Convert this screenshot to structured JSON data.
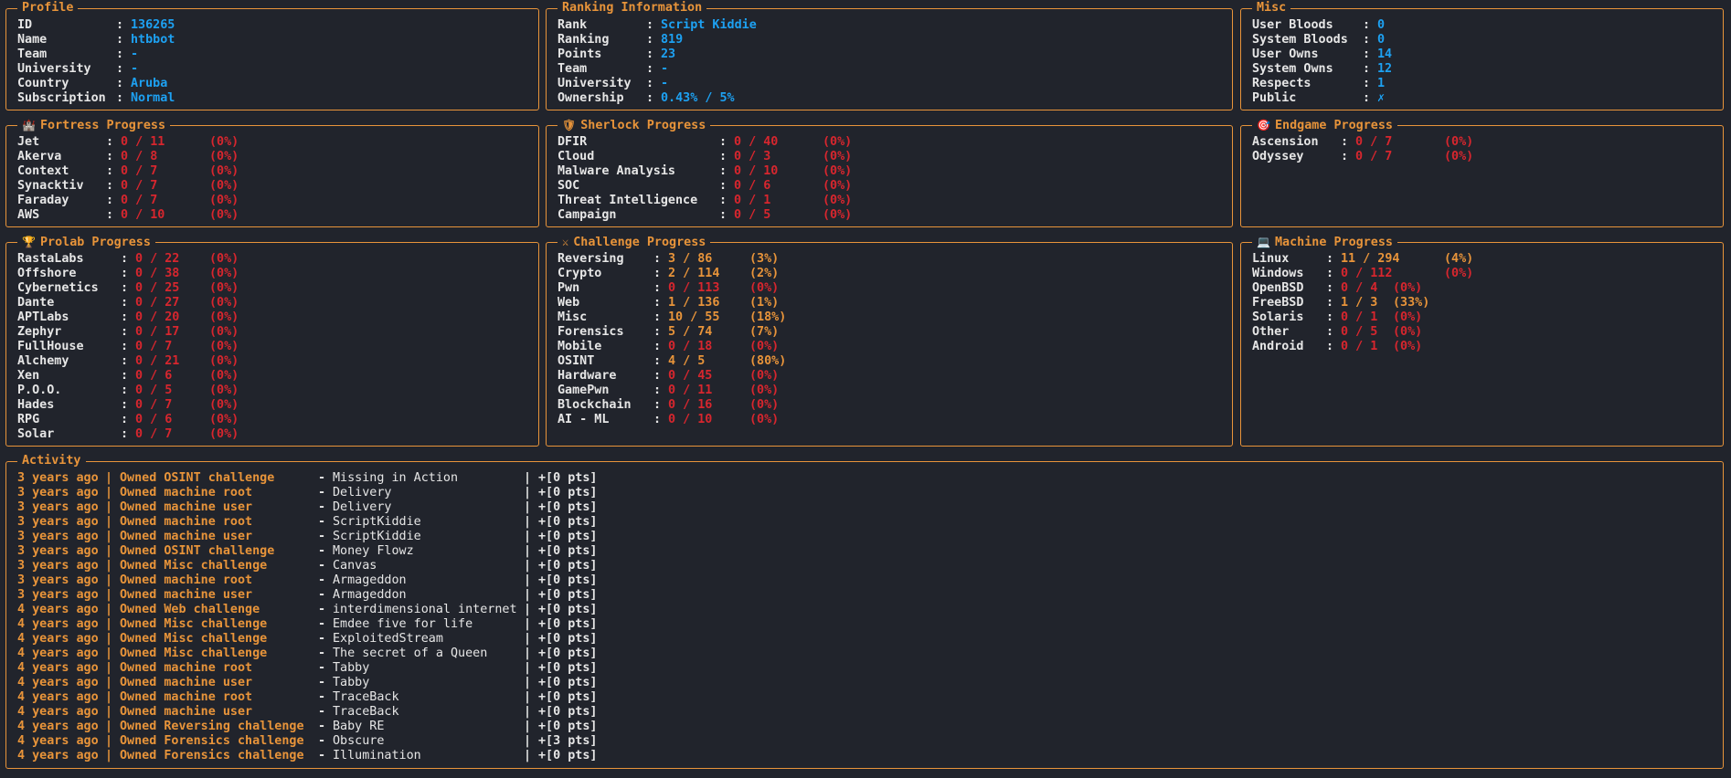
{
  "colors": {
    "accent": "#e8943a",
    "value": "#1da1f2",
    "zero": "#d7262e",
    "background": "#21242c"
  },
  "profile": {
    "title": "Profile",
    "rows": [
      {
        "label": "ID",
        "value": "136265"
      },
      {
        "label": "Name",
        "value": "htbbot"
      },
      {
        "label": "Team",
        "value": "-"
      },
      {
        "label": "University",
        "value": "-"
      },
      {
        "label": "Country",
        "value": "Aruba"
      },
      {
        "label": "Subscription",
        "value": "Normal"
      }
    ]
  },
  "ranking": {
    "title": "Ranking Information",
    "rows": [
      {
        "label": "Rank",
        "value": "Script Kiddie"
      },
      {
        "label": "Ranking",
        "value": "819"
      },
      {
        "label": "Points",
        "value": "23"
      },
      {
        "label": "Team",
        "value": "-"
      },
      {
        "label": "University",
        "value": "-"
      },
      {
        "label": "Ownership",
        "value": "0.43% / 5%"
      }
    ]
  },
  "misc": {
    "title": "Misc",
    "rows": [
      {
        "label": "User Bloods",
        "value": "0"
      },
      {
        "label": "System Bloods",
        "value": "0"
      },
      {
        "label": "User Owns",
        "value": "14"
      },
      {
        "label": "System Owns",
        "value": "12"
      },
      {
        "label": "Respects",
        "value": "1"
      },
      {
        "label": "Public",
        "value": "✗"
      }
    ]
  },
  "fortress": {
    "title": "Fortress Progress",
    "icon": "castle-icon",
    "glyph": "🏰",
    "rows": [
      {
        "label": "Jet",
        "value": "0 / 11",
        "pct": "(0%)",
        "state": "zero"
      },
      {
        "label": "Akerva",
        "value": "0 / 8",
        "pct": "(0%)",
        "state": "zero"
      },
      {
        "label": "Context",
        "value": "0 / 7",
        "pct": "(0%)",
        "state": "zero"
      },
      {
        "label": "Synacktiv",
        "value": "0 / 7",
        "pct": "(0%)",
        "state": "zero"
      },
      {
        "label": "Faraday",
        "value": "0 / 7",
        "pct": "(0%)",
        "state": "zero"
      },
      {
        "label": "AWS",
        "value": "0 / 10",
        "pct": "(0%)",
        "state": "zero"
      }
    ]
  },
  "sherlock": {
    "title": "Sherlock Progress",
    "icon": "shield-icon",
    "glyph": "🛡",
    "rows": [
      {
        "label": "DFIR",
        "value": "0 / 40",
        "pct": "(0%)",
        "state": "zero"
      },
      {
        "label": "Cloud",
        "value": "0 / 3",
        "pct": "(0%)",
        "state": "zero"
      },
      {
        "label": "Malware Analysis",
        "value": "0 / 10",
        "pct": "(0%)",
        "state": "zero"
      },
      {
        "label": "SOC",
        "value": "0 / 6",
        "pct": "(0%)",
        "state": "zero"
      },
      {
        "label": "Threat Intelligence",
        "value": "0 / 1",
        "pct": "(0%)",
        "state": "zero"
      },
      {
        "label": "Campaign",
        "value": "0 / 5",
        "pct": "(0%)",
        "state": "zero"
      }
    ]
  },
  "endgame": {
    "title": "Endgame Progress",
    "icon": "target-icon",
    "glyph": "🎯",
    "rows": [
      {
        "label": "Ascension",
        "value": "0 / 7",
        "pct": "(0%)",
        "state": "zero"
      },
      {
        "label": "Odyssey",
        "value": "0 / 7",
        "pct": "(0%)",
        "state": "zero"
      }
    ]
  },
  "prolab": {
    "title": "Prolab Progress",
    "icon": "trophy-icon",
    "glyph": "🏆",
    "rows": [
      {
        "label": "RastaLabs",
        "value": "0 / 22",
        "pct": "(0%)",
        "state": "zero"
      },
      {
        "label": "Offshore",
        "value": "0 / 38",
        "pct": "(0%)",
        "state": "zero"
      },
      {
        "label": "Cybernetics",
        "value": "0 / 25",
        "pct": "(0%)",
        "state": "zero"
      },
      {
        "label": "Dante",
        "value": "0 / 27",
        "pct": "(0%)",
        "state": "zero"
      },
      {
        "label": "APTLabs",
        "value": "0 / 20",
        "pct": "(0%)",
        "state": "zero"
      },
      {
        "label": "Zephyr",
        "value": "0 / 17",
        "pct": "(0%)",
        "state": "zero"
      },
      {
        "label": "FullHouse",
        "value": "0 / 7",
        "pct": "(0%)",
        "state": "zero"
      },
      {
        "label": "Alchemy",
        "value": "0 / 21",
        "pct": "(0%)",
        "state": "zero"
      },
      {
        "label": "Xen",
        "value": "0 / 6",
        "pct": "(0%)",
        "state": "zero"
      },
      {
        "label": "P.O.O.",
        "value": "0 / 5",
        "pct": "(0%)",
        "state": "zero"
      },
      {
        "label": "Hades",
        "value": "0 / 7",
        "pct": "(0%)",
        "state": "zero"
      },
      {
        "label": "RPG",
        "value": "0 / 6",
        "pct": "(0%)",
        "state": "zero"
      },
      {
        "label": "Solar",
        "value": "0 / 7",
        "pct": "(0%)",
        "state": "zero"
      }
    ]
  },
  "challenge": {
    "title": "Challenge Progress",
    "icon": "swords-icon",
    "glyph": "⚔",
    "rows": [
      {
        "label": "Reversing",
        "value": "3 / 86",
        "pct": "(3%)",
        "state": "done"
      },
      {
        "label": "Crypto",
        "value": "2 / 114",
        "pct": "(2%)",
        "state": "done"
      },
      {
        "label": "Pwn",
        "value": "0 / 113",
        "pct": "(0%)",
        "state": "zero"
      },
      {
        "label": "Web",
        "value": "1 / 136",
        "pct": "(1%)",
        "state": "done"
      },
      {
        "label": "Misc",
        "value": "10 / 55",
        "pct": "(18%)",
        "state": "done"
      },
      {
        "label": "Forensics",
        "value": "5 / 74",
        "pct": "(7%)",
        "state": "done"
      },
      {
        "label": "Mobile",
        "value": "0 / 18",
        "pct": "(0%)",
        "state": "zero"
      },
      {
        "label": "OSINT",
        "value": "4 / 5",
        "pct": "(80%)",
        "state": "done"
      },
      {
        "label": "Hardware",
        "value": "0 / 45",
        "pct": "(0%)",
        "state": "zero"
      },
      {
        "label": "GamePwn",
        "value": "0 / 11",
        "pct": "(0%)",
        "state": "zero"
      },
      {
        "label": "Blockchain",
        "value": "0 / 16",
        "pct": "(0%)",
        "state": "zero"
      },
      {
        "label": "AI - ML",
        "value": "0 / 10",
        "pct": "(0%)",
        "state": "zero"
      }
    ]
  },
  "machine": {
    "title": "Machine Progress",
    "icon": "laptop-icon",
    "glyph": "💻",
    "rows": [
      {
        "label": "Linux",
        "value": "11 / 294",
        "pct": "(4%)",
        "state": "done"
      },
      {
        "label": "Windows",
        "value": "0 / 112",
        "pct": "(0%)",
        "state": "zero"
      },
      {
        "label": "OpenBSD",
        "value": "0 / 4",
        "pct": "(0%)",
        "state": "zero"
      },
      {
        "label": "FreeBSD",
        "value": "1 / 3",
        "pct": "(33%)",
        "state": "done"
      },
      {
        "label": "Solaris",
        "value": "0 / 1",
        "pct": "(0%)",
        "state": "zero"
      },
      {
        "label": "Other",
        "value": "0 / 5",
        "pct": "(0%)",
        "state": "zero"
      },
      {
        "label": "Android",
        "value": "0 / 1",
        "pct": "(0%)",
        "state": "zero"
      }
    ]
  },
  "activity": {
    "title": "Activity",
    "rows": [
      {
        "when": "3 years ago",
        "action": "Owned OSINT challenge",
        "target": "Missing in Action",
        "pts": "+[0 pts]"
      },
      {
        "when": "3 years ago",
        "action": "Owned machine root",
        "target": "Delivery",
        "pts": "+[0 pts]"
      },
      {
        "when": "3 years ago",
        "action": "Owned machine user",
        "target": "Delivery",
        "pts": "+[0 pts]"
      },
      {
        "when": "3 years ago",
        "action": "Owned machine root",
        "target": "ScriptKiddie",
        "pts": "+[0 pts]"
      },
      {
        "when": "3 years ago",
        "action": "Owned machine user",
        "target": "ScriptKiddie",
        "pts": "+[0 pts]"
      },
      {
        "when": "3 years ago",
        "action": "Owned OSINT challenge",
        "target": "Money Flowz",
        "pts": "+[0 pts]"
      },
      {
        "when": "3 years ago",
        "action": "Owned Misc challenge",
        "target": "Canvas",
        "pts": "+[0 pts]"
      },
      {
        "when": "3 years ago",
        "action": "Owned machine root",
        "target": "Armageddon",
        "pts": "+[0 pts]"
      },
      {
        "when": "3 years ago",
        "action": "Owned machine user",
        "target": "Armageddon",
        "pts": "+[0 pts]"
      },
      {
        "when": "4 years ago",
        "action": "Owned Web challenge",
        "target": "interdimensional internet",
        "pts": "+[0 pts]"
      },
      {
        "when": "4 years ago",
        "action": "Owned Misc challenge",
        "target": "Emdee five for life",
        "pts": "+[0 pts]"
      },
      {
        "when": "4 years ago",
        "action": "Owned Misc challenge",
        "target": "ExploitedStream",
        "pts": "+[0 pts]"
      },
      {
        "when": "4 years ago",
        "action": "Owned Misc challenge",
        "target": "The secret of a Queen",
        "pts": "+[0 pts]"
      },
      {
        "when": "4 years ago",
        "action": "Owned machine root",
        "target": "Tabby",
        "pts": "+[0 pts]"
      },
      {
        "when": "4 years ago",
        "action": "Owned machine user",
        "target": "Tabby",
        "pts": "+[0 pts]"
      },
      {
        "when": "4 years ago",
        "action": "Owned machine root",
        "target": "TraceBack",
        "pts": "+[0 pts]"
      },
      {
        "when": "4 years ago",
        "action": "Owned machine user",
        "target": "TraceBack",
        "pts": "+[0 pts]"
      },
      {
        "when": "4 years ago",
        "action": "Owned Reversing challenge",
        "target": "Baby RE",
        "pts": "+[0 pts]"
      },
      {
        "when": "4 years ago",
        "action": "Owned Forensics challenge",
        "target": "Obscure",
        "pts": "+[3 pts]"
      },
      {
        "when": "4 years ago",
        "action": "Owned Forensics challenge",
        "target": "Illumination",
        "pts": "+[0 pts]"
      }
    ]
  }
}
